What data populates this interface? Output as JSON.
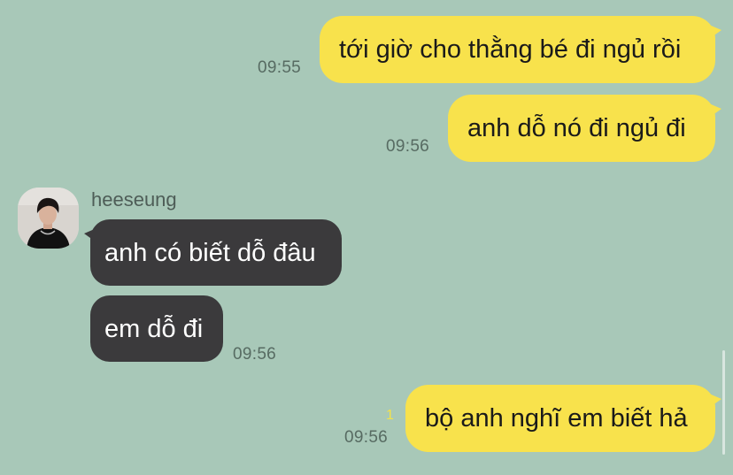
{
  "messages": {
    "m1": {
      "text": "tới giờ cho thằng bé đi ngủ rồi",
      "time": "09:55"
    },
    "m2": {
      "text": "anh dỗ nó đi ngủ đi",
      "time": "09:56"
    },
    "m3": {
      "text": "anh có biết dỗ đâu"
    },
    "m4": {
      "text": "em dỗ đi",
      "time": "09:56"
    },
    "m5": {
      "text": "bộ anh nghĩ em biết hả",
      "time": "09:56",
      "unread_count": "1"
    }
  },
  "contact": {
    "name": "heeseung",
    "avatar_icon": "profile-photo"
  },
  "colors": {
    "background": "#a8c8b8",
    "outgoing_bubble": "#f8e24c",
    "incoming_bubble": "#3b3a3c",
    "timestamp": "#576b62",
    "unread": "#f3e24a"
  }
}
